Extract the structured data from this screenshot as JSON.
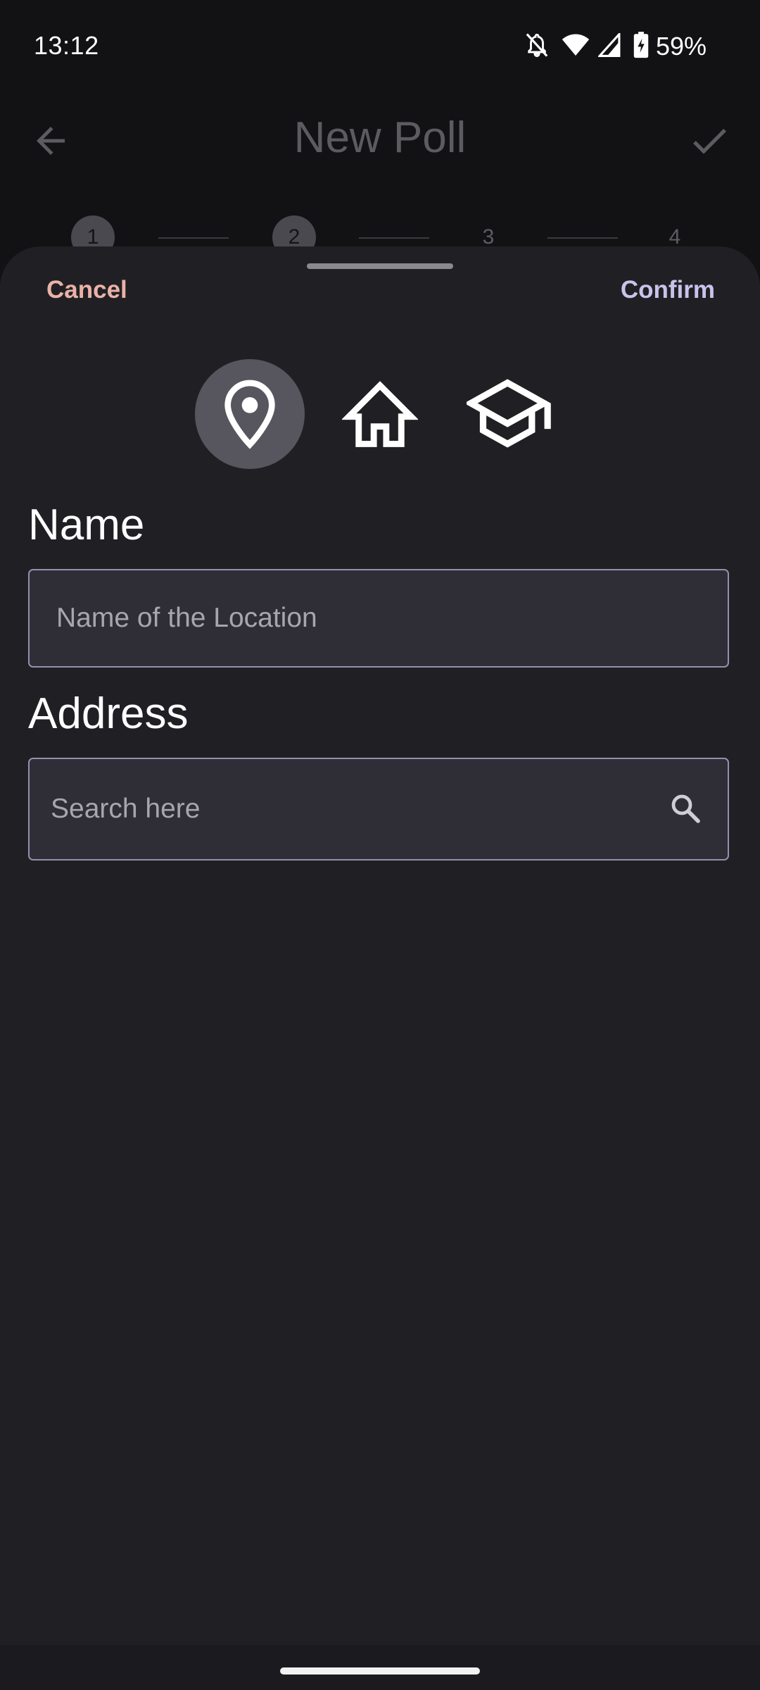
{
  "status_bar": {
    "time": "13:12",
    "battery_percent": "59%",
    "icons": [
      "bell-off-icon",
      "wifi-icon",
      "cell-signal-icon",
      "battery-charging-icon"
    ]
  },
  "app_bar": {
    "title": "New Poll",
    "back_icon": "arrow-back-icon",
    "confirm_icon": "check-icon"
  },
  "stepper": {
    "steps": [
      "1",
      "2",
      "3",
      "4"
    ],
    "active_steps": 2
  },
  "sheet": {
    "cancel_label": "Cancel",
    "confirm_label": "Confirm",
    "location_types": [
      {
        "icon": "map-pin-icon",
        "selected": true
      },
      {
        "icon": "home-icon",
        "selected": false
      },
      {
        "icon": "graduation-cap-icon",
        "selected": false
      }
    ],
    "name_label": "Name",
    "name_placeholder": "Name of the Location",
    "name_value": "",
    "address_label": "Address",
    "address_placeholder": "Search here",
    "address_value": "",
    "search_icon": "search-icon"
  },
  "colors": {
    "cancel": "#eab2a6",
    "confirm": "#c9c2ea",
    "sheet_background": "#202024",
    "field_border": "#948fb0"
  }
}
